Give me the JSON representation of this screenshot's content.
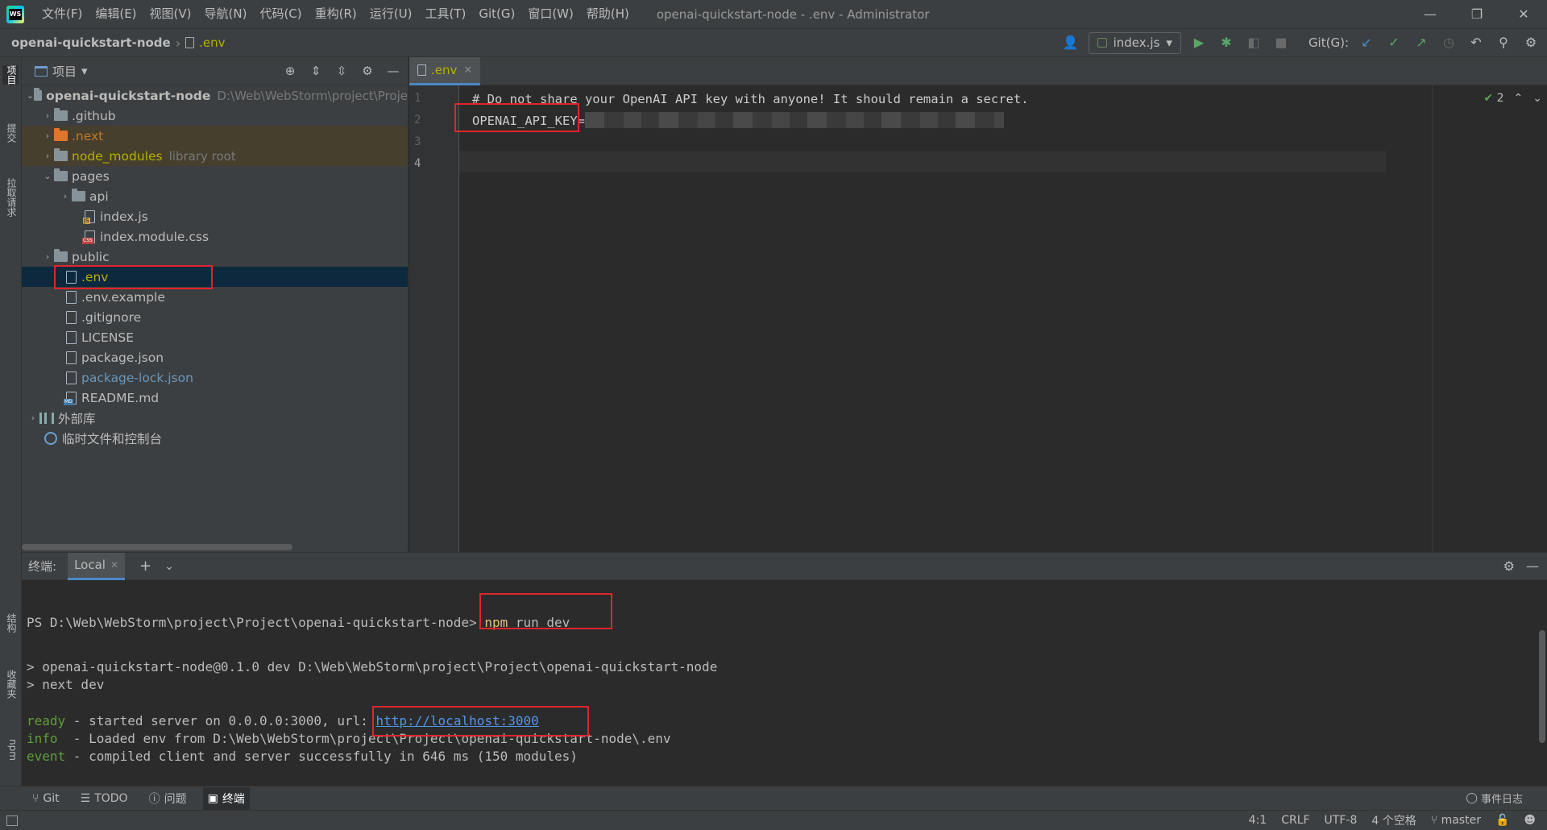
{
  "window": {
    "title": "openai-quickstart-node - .env - Administrator",
    "menu": [
      "文件(F)",
      "编辑(E)",
      "视图(V)",
      "导航(N)",
      "代码(C)",
      "重构(R)",
      "运行(U)",
      "工具(T)",
      "Git(G)",
      "窗口(W)",
      "帮助(H)"
    ],
    "controls": {
      "minimize": "—",
      "restore": "❐",
      "close": "✕"
    }
  },
  "navbar": {
    "project": "openai-quickstart-node",
    "file": ".env",
    "run_config": "index.js",
    "git_label": "Git(G):"
  },
  "left_strip": {
    "project": "项目",
    "commit": "提交",
    "pull_requests": "拉取请求",
    "structure": "结构",
    "favorites": "收藏夹",
    "npm": "npm"
  },
  "project_panel": {
    "title": "项目",
    "tree": [
      {
        "name": "openai-quickstart-node",
        "path": "D:\\Web\\WebStorm\\project\\Proje"
      },
      {
        "name": ".github"
      },
      {
        "name": ".next"
      },
      {
        "name": "node_modules",
        "extra": "library root"
      },
      {
        "name": "pages"
      },
      {
        "name": "api"
      },
      {
        "name": "index.js"
      },
      {
        "name": "index.module.css"
      },
      {
        "name": "public"
      },
      {
        "name": ".env"
      },
      {
        "name": ".env.example"
      },
      {
        "name": ".gitignore"
      },
      {
        "name": "LICENSE"
      },
      {
        "name": "package.json"
      },
      {
        "name": "package-lock.json"
      },
      {
        "name": "README.md"
      },
      {
        "name": "外部库"
      },
      {
        "name": "临时文件和控制台"
      }
    ]
  },
  "editor": {
    "tab": ".env",
    "line_numbers": [
      "1",
      "2",
      "3",
      "4"
    ],
    "lines": [
      "# Do not share your OpenAI API key with anyone! It should remain a secret.",
      "OPENAI_API_KEY="
    ],
    "inspection_count": "2"
  },
  "terminal": {
    "label": "终端:",
    "tab": "Local",
    "lines": {
      "prompt": "PS D:\\Web\\WebStorm\\project\\Project\\openai-quickstart-node>",
      "command_npm": "npm",
      "command_rest": " run dev",
      "script1": "> openai-quickstart-node@0.1.0 dev D:\\Web\\WebStorm\\project\\Project\\openai-quickstart-node",
      "script2": "> next dev",
      "ready_tag": "ready",
      "ready_text": " - started server on 0.0.0.0:3000, url: ",
      "ready_url": "http://localhost:3000",
      "info_tag": "info",
      "info_text": "  - Loaded env from D:\\Web\\WebStorm\\project\\Project\\openai-quickstart-node\\.env",
      "event_tag": "event",
      "event_text": " - compiled client and server successfully in 646 ms (150 modules)"
    }
  },
  "toolbar": {
    "git": "Git",
    "todo": "TODO",
    "problems": "问题",
    "terminal": "终端",
    "event_log": "事件日志"
  },
  "status": {
    "position": "4:1",
    "line_sep": "CRLF",
    "encoding": "UTF-8",
    "indent": "4 个空格",
    "branch": "master"
  },
  "colors": {
    "highlight_box": "#e0252b",
    "selection": "#0d293e",
    "accent": "#4a88c7"
  }
}
